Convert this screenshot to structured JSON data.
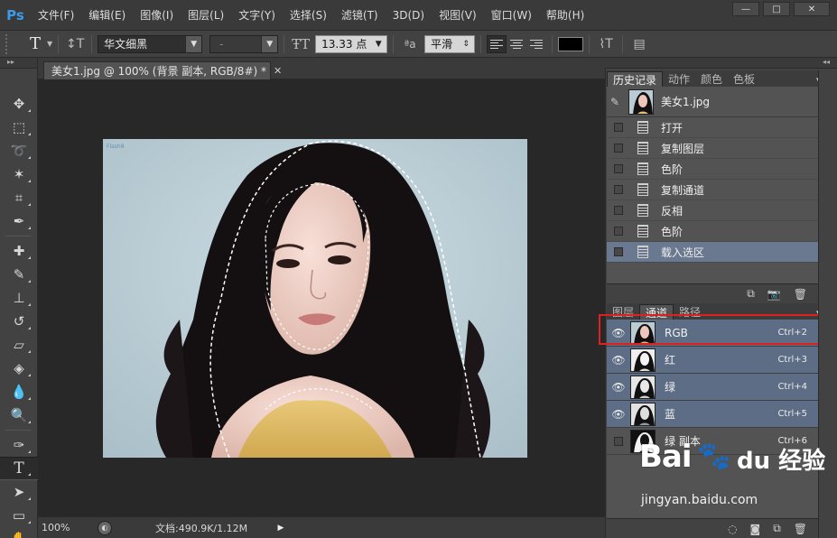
{
  "app": {
    "logo": "Ps",
    "menu": [
      "文件(F)",
      "编辑(E)",
      "图像(I)",
      "图层(L)",
      "文字(Y)",
      "选择(S)",
      "滤镜(T)",
      "3D(D)",
      "视图(V)",
      "窗口(W)",
      "帮助(H)"
    ],
    "window_controls": {
      "minimize": "—",
      "maximize": "□",
      "close": "✕"
    }
  },
  "options": {
    "tool_preset": "T",
    "font_family": "华文细黑",
    "font_style": "-",
    "font_size": "13.33 点",
    "antialias_label": "ªa",
    "antialias": "平滑",
    "text_color": "#000000"
  },
  "document": {
    "tab_title": "美女1.jpg @ 100% (背景 副本, RGB/8#) *",
    "close_glyph": "✕",
    "image_watermark": "Flash8"
  },
  "status": {
    "zoom": "100%",
    "doc_size": "文档:490.9K/1.12M"
  },
  "history_panel": {
    "tabs": [
      "历史记录",
      "动作",
      "颜色",
      "色板"
    ],
    "snapshot": "美女1.jpg",
    "steps": [
      "打开",
      "复制图层",
      "色阶",
      "复制通道",
      "反相",
      "色阶",
      "载入选区"
    ],
    "selected_step": "载入选区"
  },
  "channels_panel": {
    "tabs": [
      "图层",
      "通道",
      "路径"
    ],
    "channels": [
      {
        "name": "RGB",
        "shortcut": "Ctrl+2",
        "visible": true,
        "selected": true
      },
      {
        "name": "红",
        "shortcut": "Ctrl+3",
        "visible": true,
        "selected": true
      },
      {
        "name": "绿",
        "shortcut": "Ctrl+4",
        "visible": true,
        "selected": true
      },
      {
        "name": "蓝",
        "shortcut": "Ctrl+5",
        "visible": true,
        "selected": true
      },
      {
        "name": "绿 副本",
        "shortcut": "Ctrl+6",
        "visible": false,
        "selected": false
      }
    ]
  },
  "watermark": {
    "logo": "Bai",
    "paw": "🐾",
    "right": "du 经验",
    "sub": "jingyan.baidu.com"
  },
  "colors": {
    "accent_selection": "#5d6d86",
    "highlight_box": "#e02020",
    "ps_blue": "#3d9ae6"
  }
}
